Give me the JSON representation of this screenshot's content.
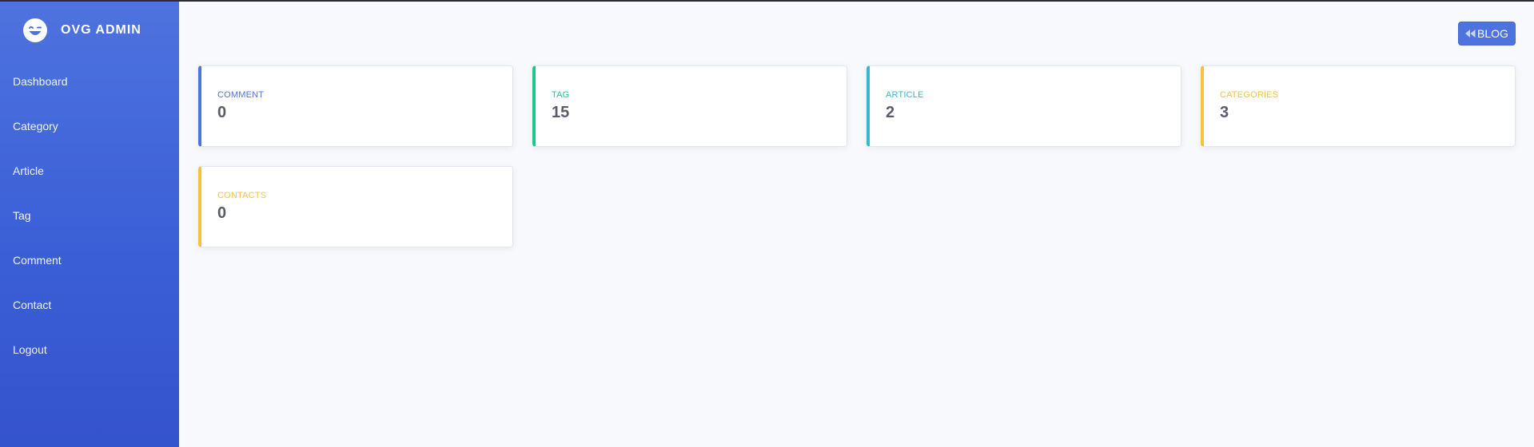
{
  "brand": {
    "title": "OVG ADMIN",
    "icon": "laugh-wink-icon"
  },
  "sidebar": {
    "items": [
      {
        "label": "Dashboard"
      },
      {
        "label": "Category"
      },
      {
        "label": "Article"
      },
      {
        "label": "Tag"
      },
      {
        "label": "Comment"
      },
      {
        "label": "Contact"
      },
      {
        "label": "Logout"
      }
    ]
  },
  "header": {
    "blog_button": "BLOG",
    "blog_icon": "angle-double-left-icon"
  },
  "cards": [
    {
      "label": "COMMENT",
      "value": "0",
      "color": "#4e73df"
    },
    {
      "label": "TAG",
      "value": "15",
      "color": "#1cc88a"
    },
    {
      "label": "ARTICLE",
      "value": "2",
      "color": "#36b9cc"
    },
    {
      "label": "CATEGORIES",
      "value": "3",
      "color": "#f6c23e"
    },
    {
      "label": "CONTACTS",
      "value": "0",
      "color": "#f6c23e"
    }
  ],
  "colors": {
    "sidebar_gradient_start": "#4e73df",
    "sidebar_gradient_end": "#3453cc",
    "background": "#f8f9fc"
  }
}
